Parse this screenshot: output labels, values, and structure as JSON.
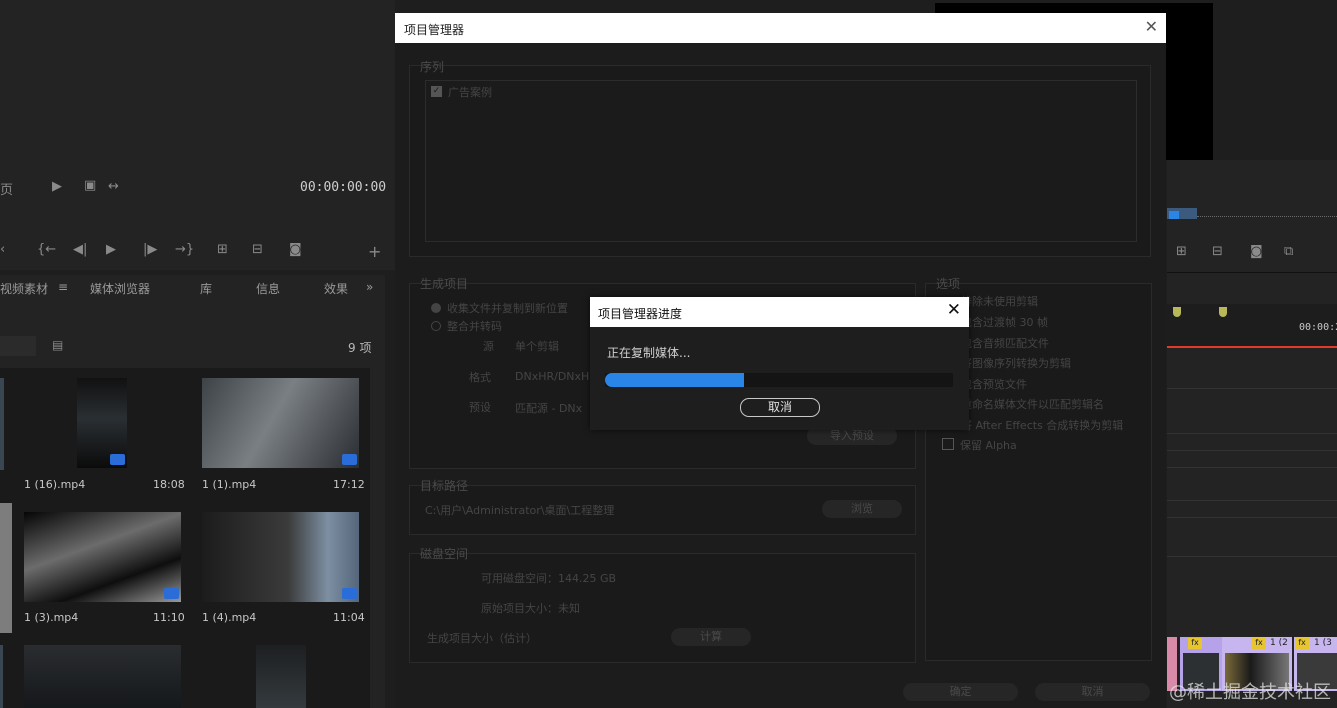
{
  "background_app": {
    "monitor_timecode": "00:00:00:00",
    "timeline_timecode": "00:00:2",
    "page_fragment": "页",
    "tabs": [
      "视频素材",
      "媒体浏览器",
      "库",
      "信息",
      "效果"
    ],
    "items_count": "9 项",
    "clips": [
      {
        "name": "1 (16).mp4",
        "duration": "18:08"
      },
      {
        "name": "1 (1).mp4",
        "duration": "17:12"
      },
      {
        "name": "1 (3).mp4",
        "duration": "11:10"
      },
      {
        "name": "1 (4).mp4",
        "duration": "11:04"
      }
    ],
    "timeline_clip_labels": [
      "fx",
      "1 (2",
      "fx",
      "1 (3"
    ]
  },
  "project_manager": {
    "title": "项目管理器",
    "sequence_label": "序列",
    "sequence_item": "广告案例",
    "generate_label": "生成项目",
    "generate_options": [
      "收集文件并复制到新位置",
      "整合并转码"
    ],
    "source_label": "源",
    "source_value": "单个剪辑",
    "format_label": "格式",
    "format_value": "DNxHR/DNxHD",
    "preset_label": "预设",
    "preset_value": "匹配源 - DNx",
    "import_preset": "导入预设",
    "options_label": "选项",
    "options": [
      "排除未使用剪辑",
      "包含过渡帧 30 帧",
      "包含音频匹配文件",
      "将图像序列转换为剪辑",
      "包含预览文件",
      "重命名媒体文件以匹配剪辑名",
      "将 After Effects 合成转换为剪辑",
      "保留 Alpha"
    ],
    "dest_label": "目标路径",
    "dest_path": "C:\\用户\\Administrator\\桌面\\工程整理",
    "browse": "浏览",
    "disk_label": "磁盘空间",
    "available": "可用磁盘空间：144.25 GB",
    "original_size": "原始项目大小：未知",
    "result_size": "生成项目大小（估计）",
    "calculate": "计算",
    "ok": "确定",
    "cancel": "取消"
  },
  "progress_dialog": {
    "title": "项目管理器进度",
    "status": "正在复制媒体...",
    "progress": 0.4,
    "cancel": "取消"
  },
  "watermark": "@稀土掘金技术社区",
  "colors": {
    "accent": "#2a86e6",
    "playhead": "#e23a2a"
  }
}
